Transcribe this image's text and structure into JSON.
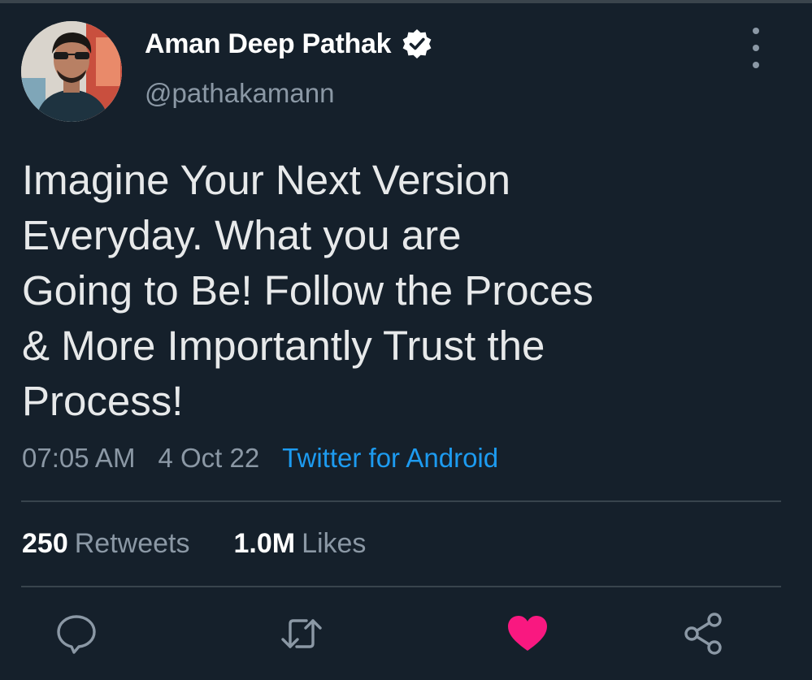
{
  "author": {
    "display_name": "Aman Deep Pathak",
    "handle": "@pathakamann",
    "verified": true
  },
  "tweet": {
    "text": "Imagine Your Next Version\nEveryday. What you are\nGoing to Be! Follow the Proces\n& More Importantly Trust the\nProcess!",
    "time": "07:05 AM",
    "date": "4 Oct 22",
    "source": "Twitter for Android"
  },
  "stats": {
    "retweets_count": "250",
    "retweets_label": "Retweets",
    "likes_count": "1.0M",
    "likes_label": "Likes"
  },
  "actions": {
    "reply_icon": "reply-bubble-icon",
    "retweet_icon": "retweet-icon",
    "like_icon": "heart-icon",
    "share_icon": "share-icon",
    "liked": true
  },
  "colors": {
    "background": "#15202b",
    "text_primary": "#e7e9ea",
    "text_secondary": "#8b98a5",
    "accent": "#1d9bf0",
    "like": "#f91880",
    "divider": "#38444d"
  }
}
